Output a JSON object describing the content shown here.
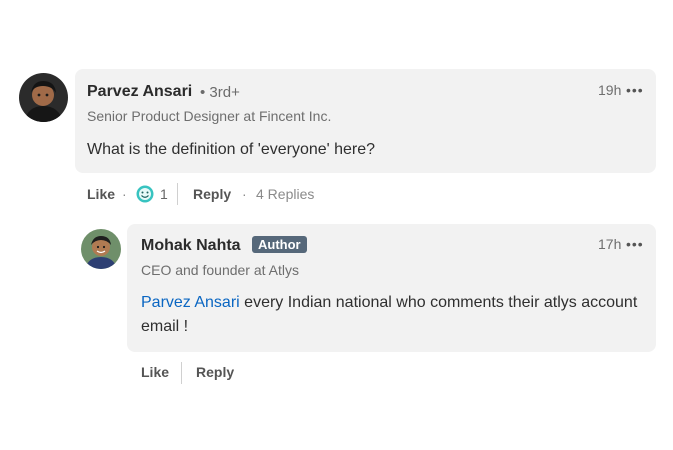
{
  "comment": {
    "author": "Parvez Ansari",
    "degree": "• 3rd+",
    "headline": "Senior Product Designer at Fincent Inc.",
    "text": "What is the definition of 'everyone' here?",
    "time": "19h",
    "more": "•••",
    "actions": {
      "like": "Like",
      "dot1": "·",
      "reaction_count": "1",
      "reply": "Reply",
      "dot2": "·",
      "replies": "4 Replies"
    }
  },
  "reply": {
    "author": "Mohak Nahta",
    "badge": "Author",
    "headline": "CEO and founder at Atlys",
    "mention": "Parvez Ansari",
    "text": " every Indian national who comments their atlys account email !",
    "time": "17h",
    "more": "•••",
    "actions": {
      "like": "Like",
      "reply": "Reply"
    }
  },
  "colors": {
    "bubble": "#f2f2f2",
    "badge": "#56687a",
    "mention": "#0a66c2"
  }
}
